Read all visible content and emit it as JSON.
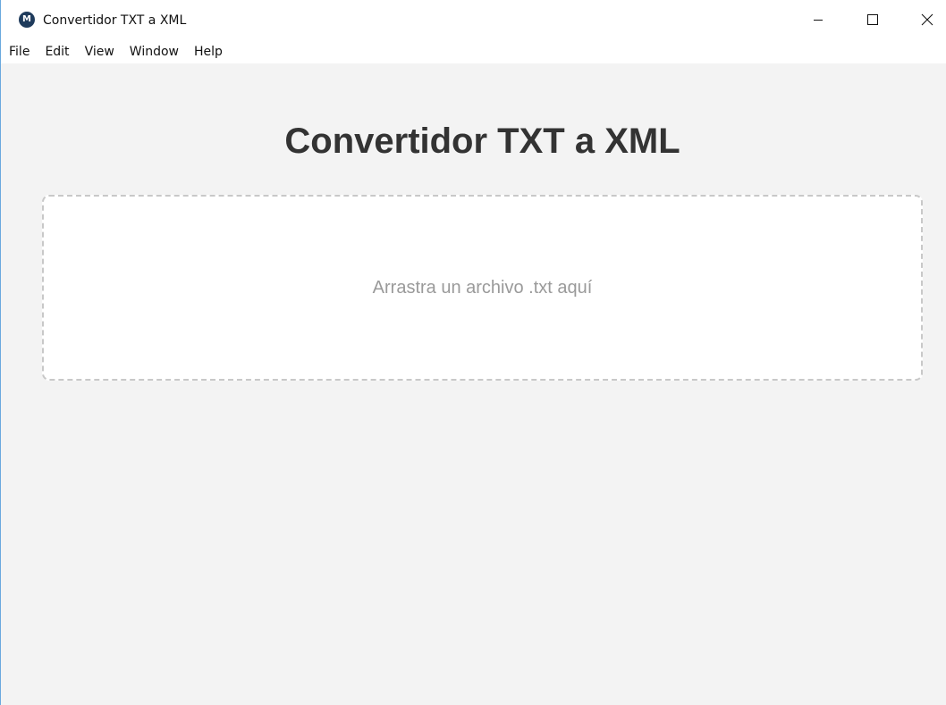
{
  "window": {
    "title": "Convertidor TXT a XML",
    "icon": "electron-app-icon",
    "controls": {
      "minimize": "minimize-icon",
      "maximize": "maximize-icon",
      "close": "close-icon"
    }
  },
  "menubar": {
    "items": [
      {
        "label": "File"
      },
      {
        "label": "Edit"
      },
      {
        "label": "View"
      },
      {
        "label": "Window"
      },
      {
        "label": "Help"
      }
    ]
  },
  "main": {
    "title": "Convertidor TXT a XML",
    "dropzone": {
      "text": "Arrastra un archivo .txt aquí"
    }
  },
  "colors": {
    "background": "#f3f3f3",
    "dropzone_border": "#c8c8c8",
    "title": "#333333",
    "dropzone_text": "#9a9a9a",
    "window_border": "#6aa9de"
  }
}
